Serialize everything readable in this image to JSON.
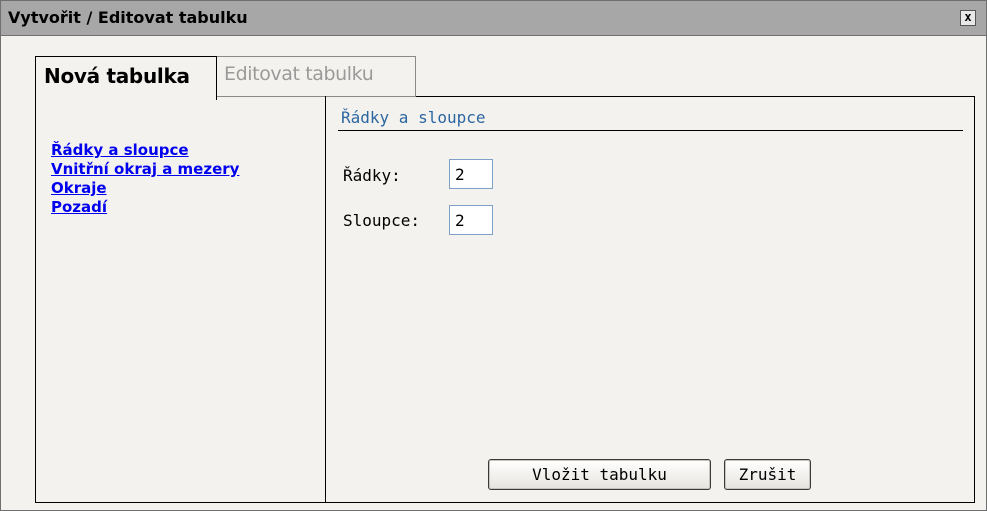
{
  "window": {
    "title": "Vytvořit / Editovat tabulku",
    "close_glyph": "x"
  },
  "tabs": [
    {
      "label": "Nová tabulka",
      "active": true
    },
    {
      "label": "Editovat tabulku",
      "active": false
    }
  ],
  "sidebar": {
    "items": [
      {
        "label": "Řádky a sloupce"
      },
      {
        "label": "Vnitřní okraj a mezery"
      },
      {
        "label": "Okraje"
      },
      {
        "label": "Pozadí"
      }
    ]
  },
  "section": {
    "title": "Řádky a sloupce",
    "rows_label": "Řádky:",
    "rows_value": "2",
    "cols_label": "Sloupce:",
    "cols_value": "2"
  },
  "buttons": {
    "insert": "Vložit tabulku",
    "cancel": "Zrušit"
  },
  "colors": {
    "titlebar": "#a7a7a7",
    "background": "#f4f2ee",
    "link": "#0000ee",
    "section_title": "#2c66a0"
  }
}
